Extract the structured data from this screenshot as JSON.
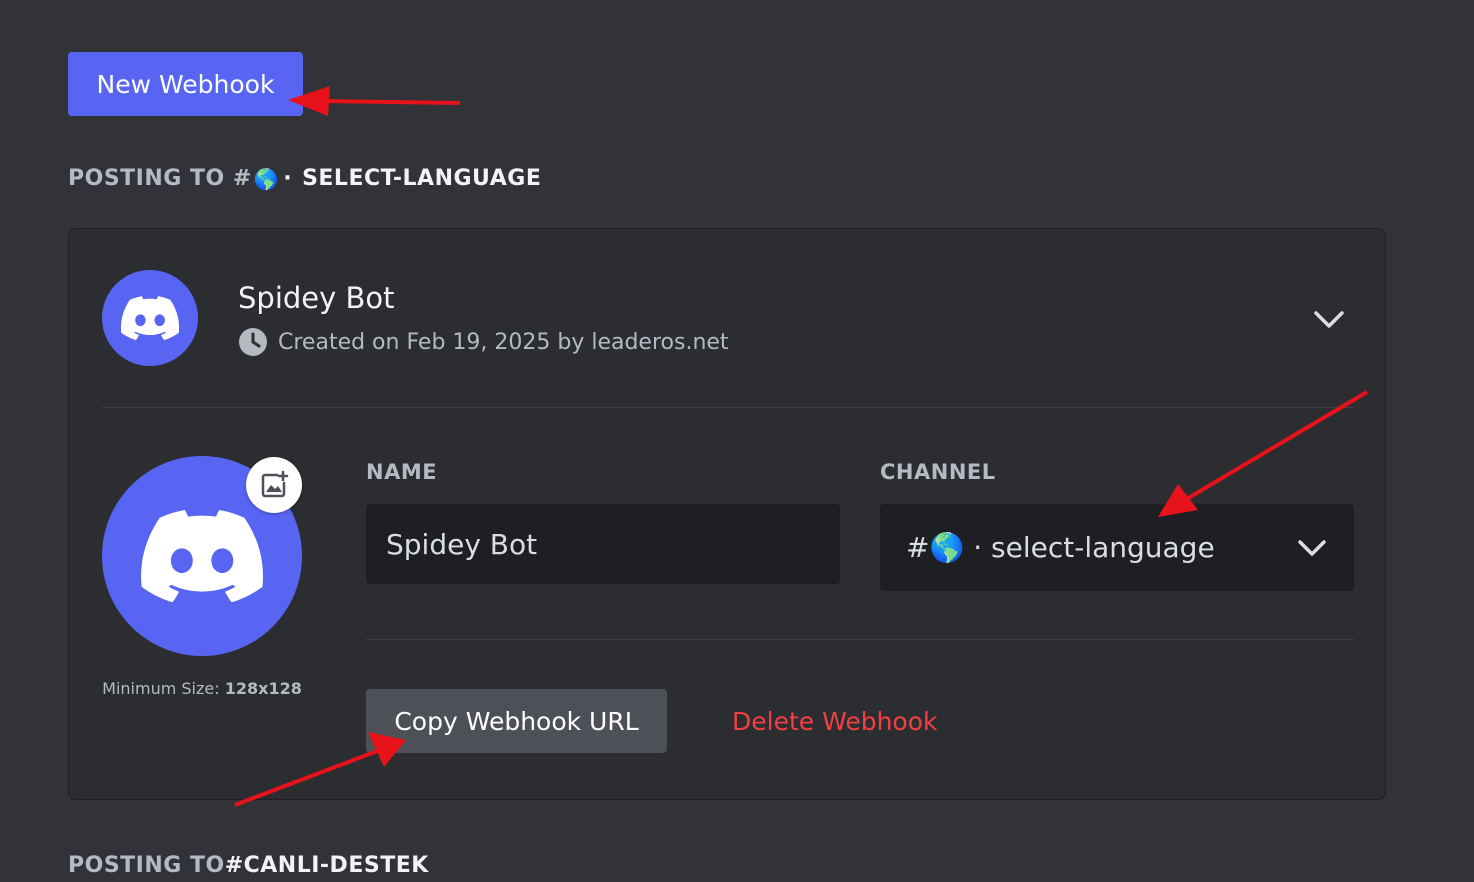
{
  "new_webhook_button": "New Webhook",
  "sections": [
    {
      "posting_prefix": "POSTING TO #",
      "channel_emoji": "🌎",
      "channel_sep": "·",
      "channel_name": "SELECT-LANGUAGE"
    },
    {
      "posting_prefix": "POSTING TO ",
      "channel_name": "#CANLI-DESTEK"
    }
  ],
  "webhook": {
    "name": "Spidey Bot",
    "created_text": "Created on Feb 19, 2025 by leaderos.net",
    "name_label": "NAME",
    "name_value": "Spidey Bot",
    "channel_label": "CHANNEL",
    "channel_value": "#🌎 · select-language",
    "min_size_label": "Minimum Size: ",
    "min_size_value": "128x128",
    "copy_button": "Copy Webhook URL",
    "delete_button": "Delete Webhook"
  },
  "colors": {
    "background": "#313338",
    "card": "#2b2d31",
    "brand": "#5865f2",
    "danger": "#f23f43",
    "annotation_arrow": "#e8121a"
  },
  "icons": [
    "discord-logo-icon",
    "clock-icon",
    "chevron-down-icon",
    "image-add-icon",
    "annotation-arrow"
  ]
}
